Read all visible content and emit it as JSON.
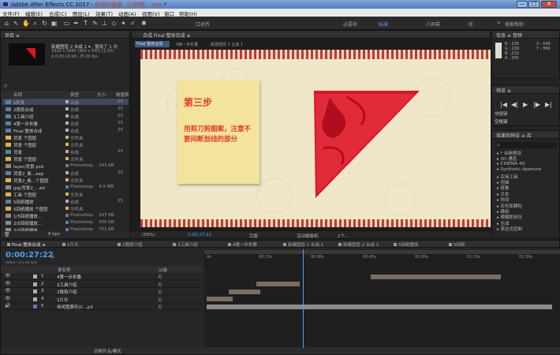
{
  "window": {
    "title_prefix": "Adobe After Effects CC 2017 - ",
    "title_file": "剪纸的画面（已转换）.aep",
    "title_suffix": " *",
    "buttons": [
      "—",
      "□",
      "✕"
    ]
  },
  "menu": [
    "文件(F)",
    "编辑(E)",
    "合成(C)",
    "图层(L)",
    "效果(T)",
    "动画(A)",
    "视图(V)",
    "窗口",
    "帮助(H)"
  ],
  "toolbar": {
    "snap_label": "口对齐",
    "workspaces": [
      "必要项",
      "标准",
      "小屏幕",
      "库"
    ],
    "active_workspace": "标准",
    "search_placeholder": "搜索帮助"
  },
  "project": {
    "title": "项目 ≡",
    "thumb_name": "新建图层 2 合成 1 ▾ , 使用了 1 次",
    "thumb_meta1": "1920 x 1080 (960 x 540) (1.00)",
    "thumb_meta2": "Δ 0:00:16:00, 25.00 fps",
    "search_placeholder": "ρ.",
    "columns": {
      "name": "名称",
      "type": "类型",
      "size": "大小",
      "fps": "帧速率"
    },
    "rows": [
      {
        "name": "1片头",
        "type": "合成",
        "size": "",
        "fps": "25",
        "kind": "comp",
        "label": "#b0b0b0"
      },
      {
        "name": "2裁剪合成",
        "type": "合成",
        "size": "",
        "fps": "25",
        "kind": "comp",
        "label": "#b0b0b0"
      },
      {
        "name": "3工具介绍",
        "type": "合成",
        "size": "",
        "fps": "25",
        "kind": "comp",
        "label": "#b0b0b0"
      },
      {
        "name": "4第一步折叠",
        "type": "合成",
        "size": "",
        "fps": "25",
        "kind": "comp",
        "label": "#b0b0b0"
      },
      {
        "name": "Final 整体合成",
        "type": "合成",
        "size": "",
        "fps": "25",
        "kind": "comp",
        "label": "#b0b0b0"
      },
      {
        "name": "背景 个图层",
        "type": "文件夹",
        "size": "",
        "fps": "",
        "kind": "folder",
        "label": "#d9b54a"
      },
      {
        "name": "背景 个图层",
        "type": "文件夹",
        "size": "",
        "fps": "",
        "kind": "folder",
        "label": "#d9b54a"
      },
      {
        "name": "背景",
        "type": "合成",
        "size": "",
        "fps": "25",
        "kind": "comp",
        "label": "#b0b0b0"
      },
      {
        "name": "背景 个图层",
        "type": "文件夹",
        "size": "",
        "fps": "",
        "kind": "folder",
        "label": "#d9b54a"
      },
      {
        "name": "layer/背景.psd",
        "type": "Photoshop",
        "size": "243 KB",
        "fps": "",
        "kind": "file",
        "label": "#5a7fa8"
      },
      {
        "name": "背景2_素...aep",
        "type": "合成",
        "size": "",
        "fps": "25",
        "kind": "comp",
        "label": "#b0b0b0"
      },
      {
        "name": "背景2_素...个图层",
        "type": "文件夹",
        "size": "",
        "fps": "",
        "kind": "folder",
        "label": "#d9b54a"
      },
      {
        "name": "jpg/背景2_...ad",
        "type": "Photoshop",
        "size": "4.9 MB",
        "fps": "",
        "kind": "file",
        "label": "#5a7fa8"
      },
      {
        "name": "工具 个图层",
        "type": "文件夹",
        "size": "",
        "fps": "",
        "kind": "folder",
        "label": "#d9b54a"
      },
      {
        "name": "5回纸播放",
        "type": "合成",
        "size": "",
        "fps": "25",
        "kind": "comp",
        "label": "#b0b0b0"
      },
      {
        "name": "5回纸播放 个图层",
        "type": "文件夹",
        "size": "",
        "fps": "",
        "kind": "folder",
        "label": "#d9b54a"
      },
      {
        "name": "1/5回纸播放...",
        "type": "Photoshop",
        "size": "297 KB",
        "fps": "",
        "kind": "file",
        "label": "#5a7fa8"
      },
      {
        "name": "2/5回纸播放...",
        "type": "Photoshop",
        "size": "355 KB",
        "fps": "",
        "kind": "file",
        "label": "#5a7fa8"
      },
      {
        "name": "3/5回纸播放...",
        "type": "Photoshop",
        "size": "721 KB",
        "fps": "",
        "kind": "file",
        "label": "#5a7fa8"
      }
    ],
    "footer_bpc": "8 bpc"
  },
  "composition": {
    "panel_title": "合成 Final 整体合成 ≡",
    "tabs": [
      "Final 整体合成",
      "4第一步折叠",
      "新建图层 2 合成 1"
    ],
    "note_heading": "第三步",
    "note_body": "用剪刀剪图案，注意不要间断划线的部分",
    "viewer_bar": {
      "zoom": "(50%)",
      "timecode": "0:00:27:22",
      "quality": "完整",
      "camera": "活动摄像机",
      "views": "1个..."
    }
  },
  "info_panel": {
    "title": "信息 ≡  音频",
    "values": [
      "R : 236",
      "G : 226",
      "B : 215",
      "A : 255",
      "X : 649",
      "Y : 399"
    ]
  },
  "preview_panel": {
    "title": "预览 ≡",
    "controls": [
      "|◀",
      "◀|",
      "▶",
      "|▶",
      "▶|"
    ],
    "shortcut_label": "快捷键",
    "shortcut_value": "空格键"
  },
  "effects_panel": {
    "title": "效果和预设 ≡  库",
    "search_placeholder": "ρ.",
    "items": [
      "▸ * 动画预设",
      "▸ 3D 通道",
      "▸ CINEMA 4D",
      "▸ Synthetic Aperture",
      "▸ 实用工具",
      "▸ 扭曲",
      "▸ 抠像",
      "▸ 文本",
      "▸ 时间",
      "▸ 杂色和颗粒",
      "▸ 模拟",
      "▸ 模糊和锐化",
      "▸ 生成",
      "▸ 表达式控制"
    ]
  },
  "timeline": {
    "tabs": [
      "Final 整体合成 ≡",
      "1片头",
      "2裁剪介绍",
      "3工具介绍",
      "4第一步折叠",
      "新建图层 2 合成 1",
      "新建图层 2 合成 2",
      "5回纸播放",
      "5回纸"
    ],
    "timecode": "0:00:27:22",
    "timecode_sub": "00697 (25.00 fps)",
    "search_placeholder": "ρ.",
    "col_source": "源名称",
    "col_parent": "父级",
    "ruler": [
      "0s",
      "00:15s",
      "00:30s",
      "00:45s",
      "01:00s",
      "01:15s",
      "01:30s"
    ],
    "layers": [
      {
        "num": "1",
        "name": "4第一步折叠",
        "parent": "无",
        "label": "#b0b0b0"
      },
      {
        "num": "2",
        "name": "3工具介绍",
        "parent": "无",
        "label": "#b0b0b0"
      },
      {
        "num": "3",
        "name": "2裁剪介绍",
        "parent": "无",
        "label": "#b0b0b0"
      },
      {
        "num": "4",
        "name": "1片头",
        "parent": "无",
        "label": "#b0b0b0"
      },
      {
        "num": "5",
        "name": "休闲宽屏乐(C...p3",
        "parent": "无",
        "label": "#5a7fa8"
      }
    ],
    "footer_toggle": "切换开关/模式"
  },
  "colors": {
    "accent": "#4aa3ff",
    "timecode": "#4aa3ff",
    "note_text": "#e23a2a",
    "paper_red": "#d9162a"
  }
}
